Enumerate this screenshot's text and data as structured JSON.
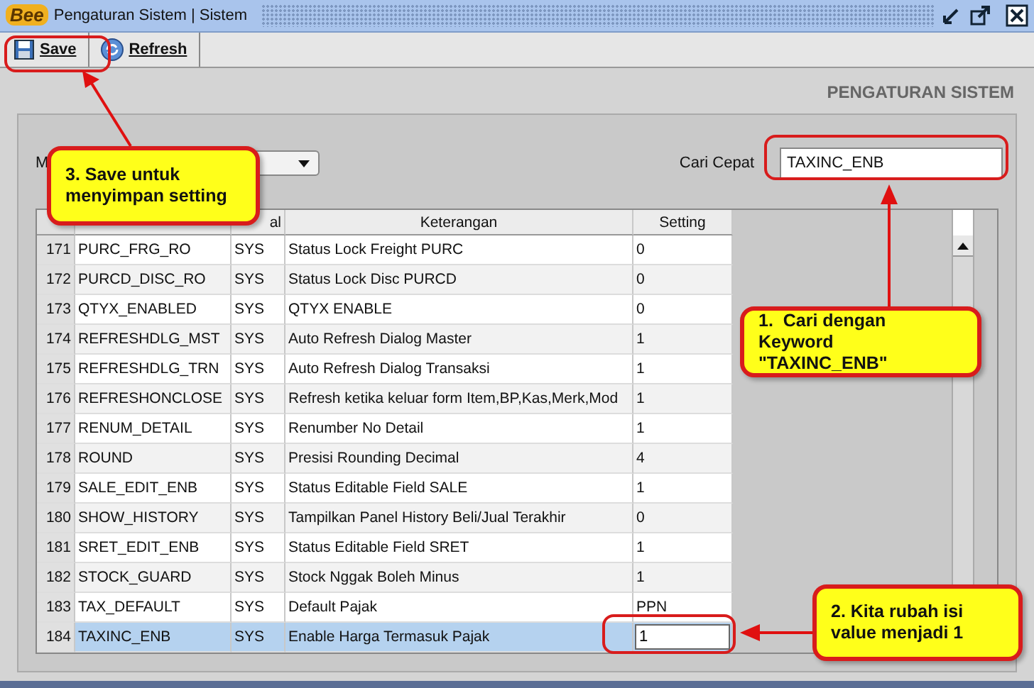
{
  "window": {
    "logo": "Bee",
    "title": "Pengaturan Sistem | Sistem"
  },
  "toolbar": [
    {
      "label": "Save",
      "kind": "save"
    },
    {
      "label": "Refresh",
      "kind": "refresh"
    }
  ],
  "page_title": "PENGATURAN SISTEM",
  "filter": {
    "label": "M"
  },
  "search": {
    "label": "Cari Cepat",
    "value": "TAXINC_ENB"
  },
  "table": {
    "columns": [
      "",
      "",
      "al",
      "Keterangan",
      "Setting"
    ],
    "rows": [
      {
        "cells": [
          "171",
          "PURC_FRG_RO",
          "SYS",
          "Status Lock Freight PURC",
          "0"
        ],
        "selected": false,
        "editing": false
      },
      {
        "cells": [
          "172",
          "PURCD_DISC_RO",
          "SYS",
          "Status Lock Disc PURCD",
          "0"
        ],
        "selected": false,
        "editing": false
      },
      {
        "cells": [
          "173",
          "QTYX_ENABLED",
          "SYS",
          "QTYX ENABLE",
          "0"
        ],
        "selected": false,
        "editing": false
      },
      {
        "cells": [
          "174",
          "REFRESHDLG_MST",
          "SYS",
          "Auto Refresh Dialog Master",
          "1"
        ],
        "selected": false,
        "editing": false
      },
      {
        "cells": [
          "175",
          "REFRESHDLG_TRN",
          "SYS",
          "Auto Refresh Dialog Transaksi",
          "1"
        ],
        "selected": false,
        "editing": false
      },
      {
        "cells": [
          "176",
          "REFRESHONCLOSE",
          "SYS",
          "Refresh ketika keluar form Item,BP,Kas,Merk,Mod",
          "1"
        ],
        "selected": false,
        "editing": false
      },
      {
        "cells": [
          "177",
          "RENUM_DETAIL",
          "SYS",
          "Renumber No Detail",
          "1"
        ],
        "selected": false,
        "editing": false
      },
      {
        "cells": [
          "178",
          "ROUND",
          "SYS",
          "Presisi Rounding Decimal",
          "4"
        ],
        "selected": false,
        "editing": false
      },
      {
        "cells": [
          "179",
          "SALE_EDIT_ENB",
          "SYS",
          "Status Editable Field SALE",
          "1"
        ],
        "selected": false,
        "editing": false
      },
      {
        "cells": [
          "180",
          "SHOW_HISTORY",
          "SYS",
          "Tampilkan Panel History Beli/Jual Terakhir",
          "0"
        ],
        "selected": false,
        "editing": false
      },
      {
        "cells": [
          "181",
          "SRET_EDIT_ENB",
          "SYS",
          "Status Editable Field SRET",
          "1"
        ],
        "selected": false,
        "editing": false
      },
      {
        "cells": [
          "182",
          "STOCK_GUARD",
          "SYS",
          "Stock Nggak Boleh Minus",
          "1"
        ],
        "selected": false,
        "editing": false
      },
      {
        "cells": [
          "183",
          "TAX_DEFAULT",
          "SYS",
          "Default Pajak",
          "PPN"
        ],
        "selected": false,
        "editing": false
      },
      {
        "cells": [
          "184",
          "TAXINC_ENB",
          "SYS",
          "Enable Harga Termasuk Pajak",
          "1"
        ],
        "selected": true,
        "editing": true
      }
    ]
  },
  "callouts": [
    {
      "text": "3. Save untuk menyimpan setting"
    },
    {
      "text": "1.  Cari dengan Keyword \"TAXINC_ENB\""
    },
    {
      "text": "2. Kita rubah isi value menjadi 1"
    }
  ]
}
